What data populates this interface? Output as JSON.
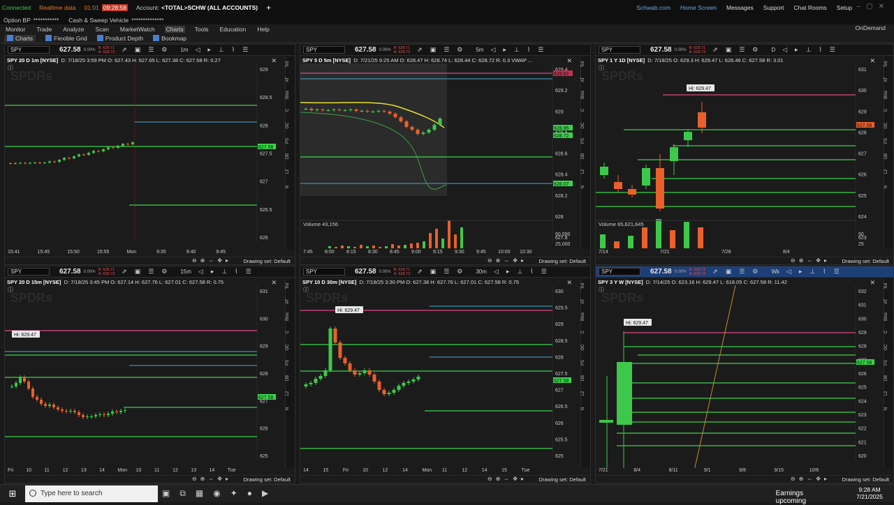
{
  "status": {
    "connected": "Connected",
    "realtime": "Realtime data",
    "timer": "01:01",
    "clock": "09:28:58",
    "account_label": "Account:",
    "account": "<TOTAL>SCHW (ALL ACCOUNTS)",
    "add": "+"
  },
  "toplinks": [
    "Schwab.com",
    "Home Screen",
    "Messages",
    "Support",
    "Chat Rooms",
    "Setup"
  ],
  "sub": {
    "option_bp": "Option BP",
    "bp_masked": "***********",
    "cash_sweep": "Cash & Sweep Vehicle",
    "cash_masked": "**************"
  },
  "menu": [
    "Monitor",
    "Trade",
    "Analyze",
    "Scan",
    "MarketWatch",
    "Charts",
    "Tools",
    "Education",
    "Help"
  ],
  "ondemand": "OnDemand",
  "subtabs": [
    "Charts",
    "Flexible Grid",
    "Product Depth",
    "Bookmap"
  ],
  "drawing_set": "Drawing set: Default",
  "side_tabs": [
    "Trd",
    "AT",
    "Btns",
    "C",
    "OC",
    "PS",
    "DB",
    "L2",
    "N"
  ],
  "panels": [
    {
      "sym": "SPY",
      "price": "627.58",
      "change": "0.00%",
      "bid": "B: 628.71",
      "ask": "A: 628.73",
      "agg": "1m",
      "desc": "SPY 20 D 1m [NYSE]",
      "ohlc": "D: 7/18/25 3:59 PM  O: 627.43  H: 627.65  L: 627.38  C: 627.58  R: 0.27",
      "yaxis": [
        "629",
        "628.5",
        "628",
        "627.5",
        "627",
        "626.5",
        "626"
      ],
      "tag": "627.58",
      "xaxis": [
        "15:41",
        "15:45",
        "15:50",
        "15:55",
        "Mon",
        "9:35",
        "9:40",
        "9:45"
      ]
    },
    {
      "sym": "SPY",
      "price": "627.58",
      "change": "0.00%",
      "bid": "B: 628.71",
      "ask": "A: 628.73",
      "agg": "5m",
      "desc": "SPY 5 D 5m [NYSE]",
      "ohlc": "D: 7/21/25 9:25 AM  O: 628.47  H: 628.74  L: 628.44  C: 628.72  R: 0.3  VWAP ...",
      "yaxis": [
        "629.4",
        "629.2",
        "629",
        "628.8",
        "628.6",
        "628.4",
        "628.2",
        "628",
        "627.8"
      ],
      "tags": [
        "629.62",
        "628.85",
        "628.72",
        "628.07"
      ],
      "volume": "Volume  43,156",
      "vaxis": [
        "50,000",
        "25,000"
      ],
      "xaxis": [
        "7:45",
        "8:00",
        "8:15",
        "8:30",
        "8:45",
        "9:00",
        "9:15",
        "9:30",
        "9:45",
        "10:00",
        "10:30"
      ]
    },
    {
      "sym": "SPY",
      "price": "627.58",
      "change": "0.00%",
      "bid": "B: 628.71",
      "ask": "A: 628.73",
      "agg": "D",
      "desc": "SPY 1 Y 1D [NYSE]",
      "ohlc": "D: 7/18/25  O: 629.3  H: 629.47  L: 626.46  C: 627.58  R: 3.01",
      "hi": "Hi: 629.47",
      "yaxis": [
        "631",
        "630",
        "629",
        "628",
        "627",
        "626",
        "625",
        "624",
        "623"
      ],
      "tag": "627.58",
      "volume": "Volume  65,621,645",
      "vaxis": [
        "50",
        "25"
      ],
      "vunit": "millions",
      "xaxis": [
        "7/14",
        "7/21",
        "7/28",
        "8/4"
      ]
    },
    {
      "sym": "SPY",
      "price": "627.58",
      "change": "0.00%",
      "bid": "B: 628.71",
      "ask": "A: 628.73",
      "agg": "15m",
      "desc": "SPY 20 D 15m [NYSE]",
      "ohlc": "D: 7/18/25 3:45 PM  O: 627.14  H: 627.76  L: 627.01  C: 627.58  R: 0.75",
      "hi": "Hi: 629.47",
      "yaxis": [
        "631",
        "630",
        "629",
        "628",
        "627",
        "626",
        "625"
      ],
      "tag": "627.58",
      "xaxis": [
        "Fri",
        "10",
        "11",
        "12",
        "13",
        "14",
        "Mon",
        "10",
        "11",
        "12",
        "13",
        "14",
        "Tue"
      ]
    },
    {
      "sym": "SPY",
      "price": "627.58",
      "change": "0.00%",
      "bid": "B: 628.71",
      "ask": "A: 628.73",
      "agg": "30m",
      "desc": "SPY 10 D 30m [NYSE]",
      "ohlc": "D: 7/18/25 3:30 PM  O: 627.38  H: 627.76  L: 627.01  C: 627.58  R: 0.75",
      "hi": "Hi: 629.47",
      "yaxis": [
        "630",
        "629.5",
        "629",
        "628.5",
        "628",
        "627.5",
        "627",
        "626.5",
        "626",
        "625.5",
        "625"
      ],
      "tag": "627.58",
      "xaxis": [
        "14",
        "15",
        "Fri",
        "10",
        "12",
        "14",
        "Mon",
        "11",
        "12",
        "14",
        "15",
        "Tue"
      ]
    },
    {
      "sym": "SPY",
      "price": "627.58",
      "change": "0.00%",
      "bid": "B: 628.71",
      "ask": "A: 628.73",
      "agg": "Wk",
      "desc": "SPY 3 Y W [NYSE]",
      "ohlc": "D: 7/14/25  O: 623.16  H: 629.47  L: 618.05  C: 627.58  R: 11.42",
      "hi": "Hi: 629.47",
      "yaxis": [
        "632",
        "631",
        "630",
        "629",
        "628",
        "627",
        "626",
        "625",
        "624",
        "623",
        "622",
        "621",
        "620"
      ],
      "tag": "627.58",
      "xaxis": [
        "7/21",
        "8/4",
        "8/11",
        "9/1",
        "9/8",
        "9/15",
        "10/6"
      ]
    }
  ],
  "taskbar": {
    "search": "Type here to search",
    "weather": "Earnings upcoming",
    "time": "9:28 AM",
    "date": "7/21/2025"
  },
  "colors": {
    "up": "#3ec84b",
    "down": "#e9602a",
    "line": "#39d44a",
    "pink": "#e04888",
    "blue": "#4a7fcf"
  }
}
